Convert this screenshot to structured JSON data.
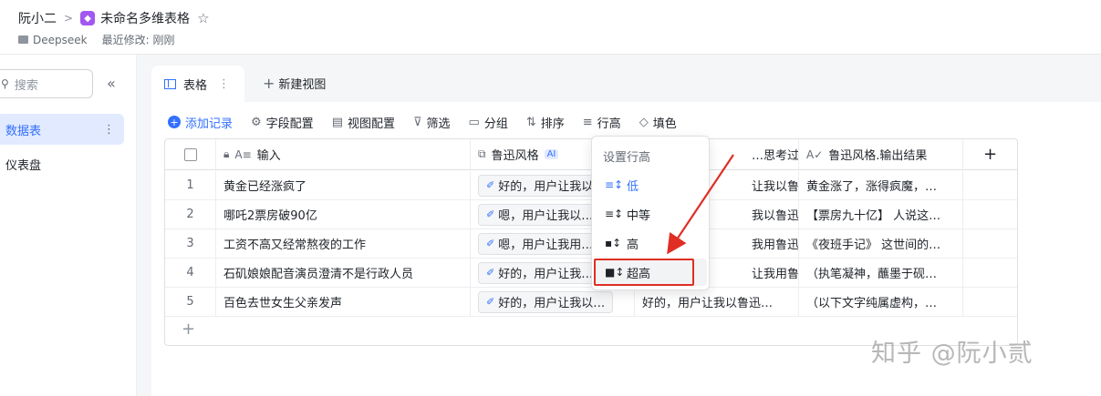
{
  "header": {
    "owner": "阮小二",
    "doc_title": "未命名多维表格",
    "folder": "Deepseek",
    "modified": "最近修改: 刚刚"
  },
  "sidebar": {
    "search_placeholder": "搜索",
    "items": [
      {
        "label": "数据表",
        "active": true
      },
      {
        "label": "仪表盘",
        "active": false
      }
    ]
  },
  "tabs": {
    "active_label": "表格",
    "new_view_label": "新建视图"
  },
  "toolbar": {
    "add_record": "添加记录",
    "field_config": "字段配置",
    "view_config": "视图配置",
    "filter": "筛选",
    "group": "分组",
    "sort": "排序",
    "row_height": "行高",
    "fill": "填色"
  },
  "table": {
    "columns": [
      "输入",
      "鲁迅风格",
      "…思考过程",
      "鲁迅风格.输出结果"
    ],
    "ai_badge": "AI",
    "rows": [
      {
        "num": "1",
        "input": "黄金已经涨疯了",
        "style": "好的，用户让我以…",
        "thinking": "让我以鲁迅…",
        "output": "黄金涨了，涨得疯魔，…"
      },
      {
        "num": "2",
        "input": "哪吒2票房破90亿",
        "style": "嗯，用户让我以…",
        "thinking": "我以鲁迅的…",
        "output": "【票房九十亿】 人说这…"
      },
      {
        "num": "3",
        "input": "工资不高又经常熬夜的工作",
        "style": "嗯，用户让我用…",
        "thinking": "我用鲁迅的…",
        "output": "《夜班手记》 这世间的…"
      },
      {
        "num": "4",
        "input": "石矶娘娘配音演员澄清不是行政人员",
        "style": "好的，用户让我…",
        "thinking": "让我用鲁迅…",
        "output": "（执笔凝神，蘸墨于砚…"
      },
      {
        "num": "5",
        "input": "百色去世女生父亲发声",
        "style": "好的，用户让我以…",
        "thinking": "好的，用户让我以鲁迅…",
        "output": "（以下文字纯属虚构，…"
      }
    ]
  },
  "row_height_menu": {
    "title": "设置行高",
    "options": [
      {
        "label": "低",
        "selected": true
      },
      {
        "label": "中等",
        "selected": false
      },
      {
        "label": "高",
        "selected": false
      },
      {
        "label": "超高",
        "selected": false
      }
    ]
  },
  "colors": {
    "accent": "#3370ff",
    "highlight": "#e02e24"
  },
  "watermark": "知乎 @阮小贰"
}
